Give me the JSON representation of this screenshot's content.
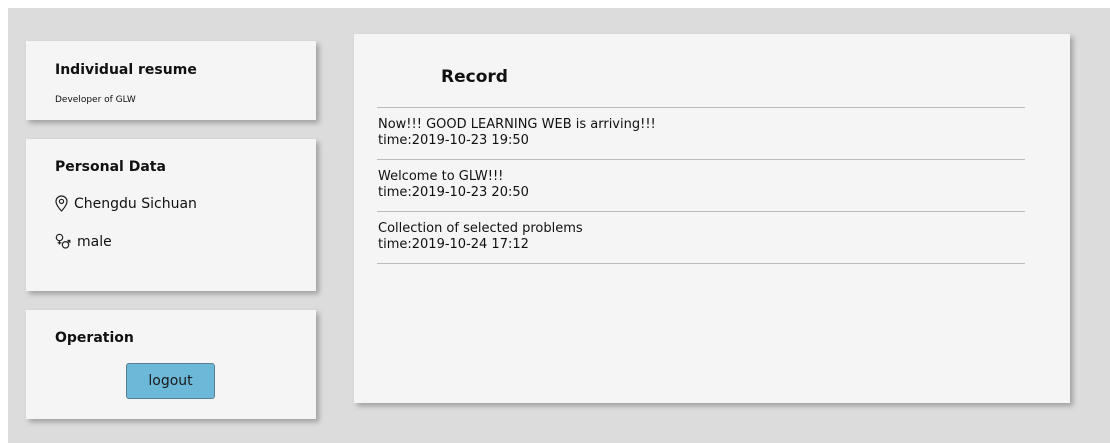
{
  "resume": {
    "title": "Individual resume",
    "subtitle": "Developer of GLW"
  },
  "personal": {
    "title": "Personal Data",
    "location": "Chengdu Sichuan",
    "location_icon": "location-pin-icon",
    "gender": "male",
    "gender_icon": "gender-icon"
  },
  "operation": {
    "title": "Operation",
    "logout_label": "logout",
    "button_color": "#6bb8d9"
  },
  "record": {
    "title": "Record",
    "items": [
      {
        "text": "Now!!! GOOD LEARNING WEB is arriving!!!",
        "time": "time:2019-10-23 19:50"
      },
      {
        "text": "Welcome to GLW!!!",
        "time": "time:2019-10-23 20:50"
      },
      {
        "text": "Collection of selected problems",
        "time": "time:2019-10-24 17:12"
      }
    ]
  }
}
